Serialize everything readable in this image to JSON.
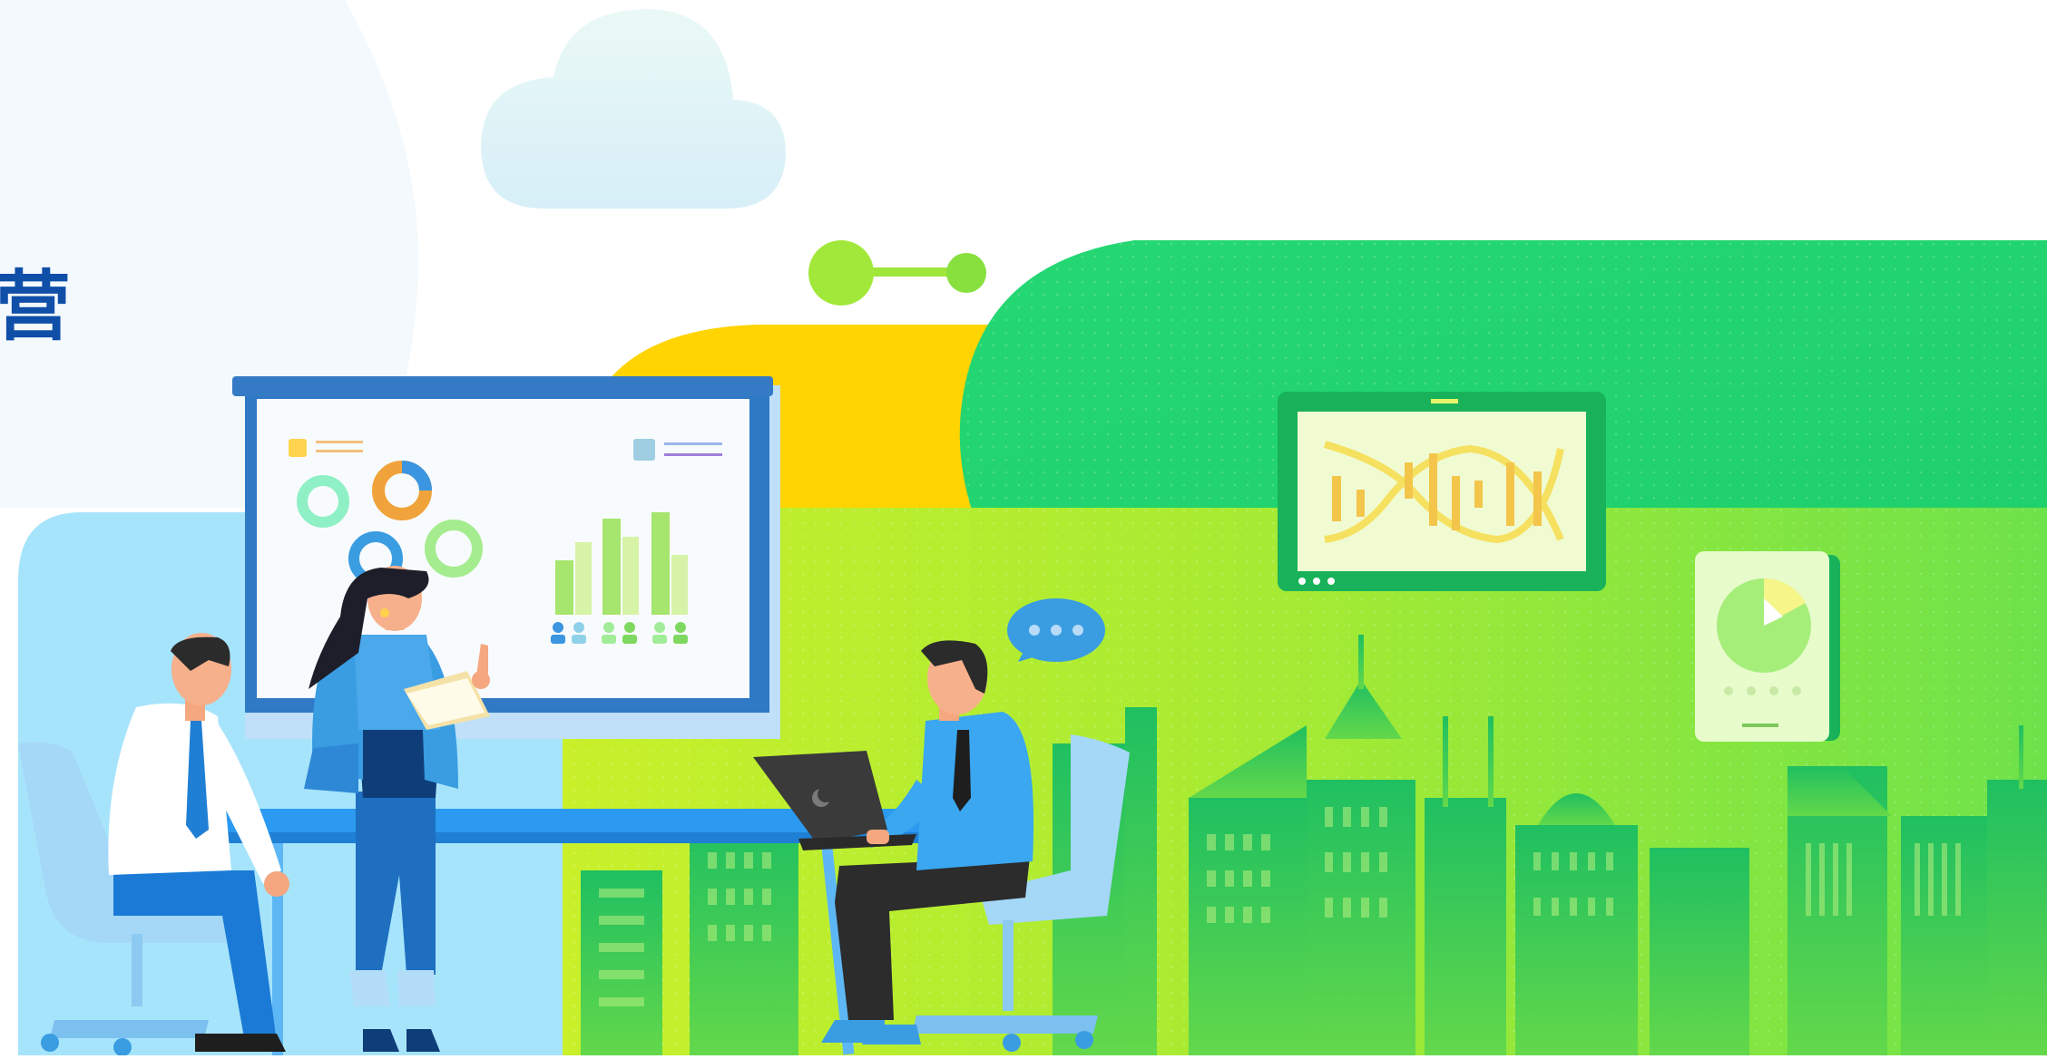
{
  "banner": {
    "heading_fragment": "营",
    "icons": [
      "cloud-icon",
      "connector-icon",
      "presentation-board",
      "dna-screen-icon",
      "pie-chart-tablet-icon",
      "speech-bubble-icon",
      "laptop-icon",
      "city-skyline"
    ],
    "colors": {
      "brand_blue": "#0f4fa8",
      "green": "#22d46f",
      "lime": "#a8ec2f",
      "yellow": "#ffd400",
      "light_blue": "#a6e4fb"
    }
  }
}
